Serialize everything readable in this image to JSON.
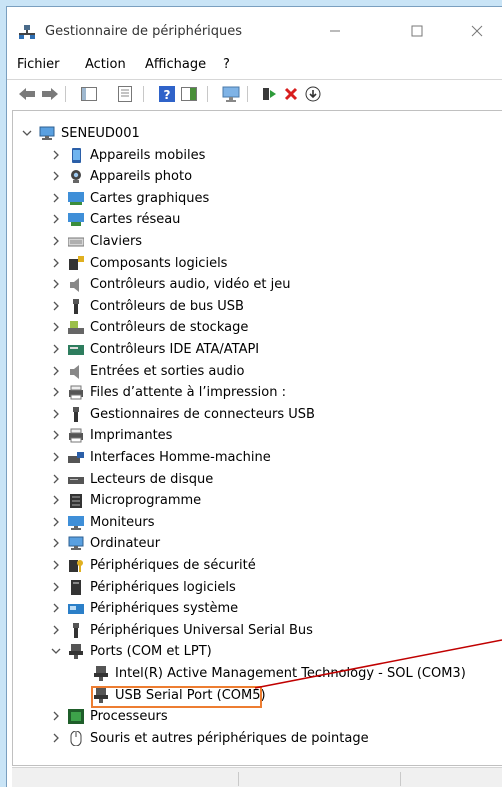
{
  "window": {
    "title": "Gestionnaire de périphériques"
  },
  "menu": [
    "Fichier",
    "Action",
    "Affichage",
    "?"
  ],
  "tree": {
    "root": "SENEUD001",
    "items": [
      {
        "label": "Appareils mobiles",
        "icon": "mobile-device-icon"
      },
      {
        "label": "Appareils photo",
        "icon": "camera-icon"
      },
      {
        "label": "Cartes graphiques",
        "icon": "display-adapter-icon"
      },
      {
        "label": "Cartes réseau",
        "icon": "network-adapter-icon"
      },
      {
        "label": "Claviers",
        "icon": "keyboard-icon"
      },
      {
        "label": "Composants logiciels",
        "icon": "software-component-icon"
      },
      {
        "label": "Contrôleurs audio, vidéo et jeu",
        "icon": "audio-controller-icon"
      },
      {
        "label": "Contrôleurs de bus USB",
        "icon": "usb-controller-icon"
      },
      {
        "label": "Contrôleurs de stockage",
        "icon": "storage-controller-icon"
      },
      {
        "label": "Contrôleurs IDE ATA/ATAPI",
        "icon": "ide-controller-icon"
      },
      {
        "label": "Entrées et sorties audio",
        "icon": "audio-io-icon"
      },
      {
        "label": "Files d’attente à l’impression :",
        "icon": "print-queue-icon"
      },
      {
        "label": "Gestionnaires de connecteurs USB",
        "icon": "usb-connector-icon"
      },
      {
        "label": "Imprimantes",
        "icon": "printer-icon"
      },
      {
        "label": "Interfaces Homme-machine",
        "icon": "hid-icon"
      },
      {
        "label": "Lecteurs de disque",
        "icon": "disk-drive-icon"
      },
      {
        "label": "Microprogramme",
        "icon": "firmware-icon"
      },
      {
        "label": "Moniteurs",
        "icon": "monitor-icon"
      },
      {
        "label": "Ordinateur",
        "icon": "computer-icon"
      },
      {
        "label": "Périphériques de sécurité",
        "icon": "security-device-icon"
      },
      {
        "label": "Périphériques logiciels",
        "icon": "software-device-icon"
      },
      {
        "label": "Périphériques système",
        "icon": "system-device-icon"
      },
      {
        "label": "Périphériques Universal Serial Bus",
        "icon": "usb-device-icon"
      },
      {
        "label": "Ports (COM et LPT)",
        "icon": "port-icon",
        "expanded": true,
        "children": [
          {
            "label": "Intel(R) Active Management Technology - SOL (COM3)",
            "icon": "port-icon"
          },
          {
            "label": "USB Serial Port (COM5)",
            "icon": "port-icon",
            "highlighted": true
          }
        ]
      },
      {
        "label": "Processeurs",
        "icon": "processor-icon"
      },
      {
        "label": "Souris et autres périphériques de pointage",
        "icon": "mouse-icon"
      }
    ]
  },
  "colors": {
    "highlight": "#ed7d31",
    "annotation_arrow": "#c00000"
  }
}
